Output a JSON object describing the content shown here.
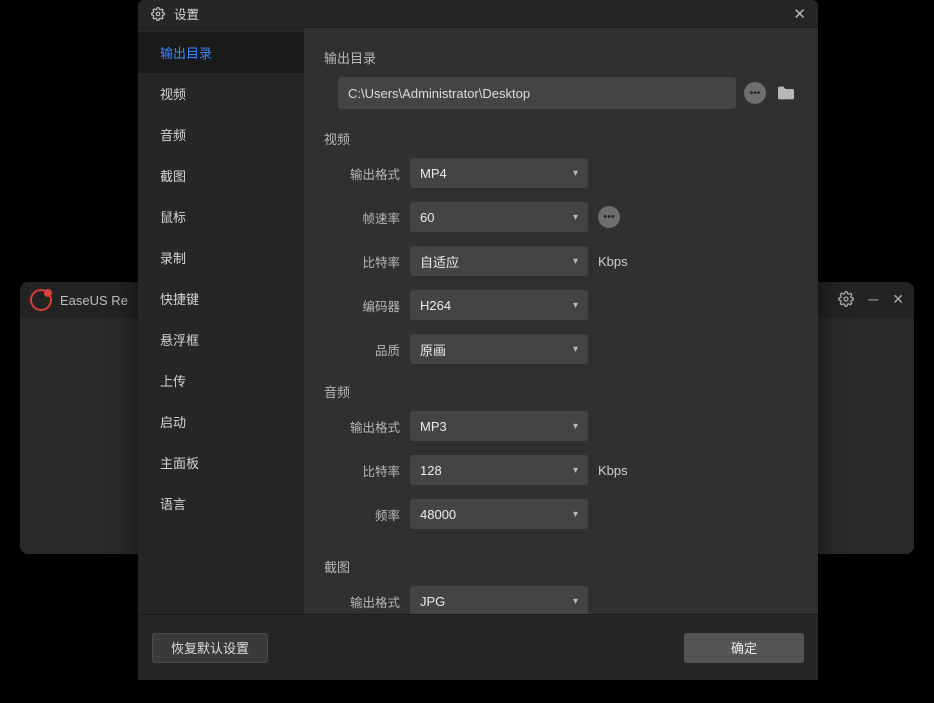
{
  "app": {
    "title": "EaseUS Re"
  },
  "modal": {
    "title": "设置"
  },
  "sidebar": {
    "items": [
      {
        "label": "输出目录",
        "active": true
      },
      {
        "label": "视频"
      },
      {
        "label": "音频"
      },
      {
        "label": "截图"
      },
      {
        "label": "鼠标"
      },
      {
        "label": "录制"
      },
      {
        "label": "快捷键"
      },
      {
        "label": "悬浮框"
      },
      {
        "label": "上传"
      },
      {
        "label": "启动"
      },
      {
        "label": "主面板"
      },
      {
        "label": "语言"
      }
    ]
  },
  "sections": {
    "output_dir": {
      "title": "输出目录",
      "path": "C:\\Users\\Administrator\\Desktop"
    },
    "video": {
      "title": "视频",
      "format_label": "输出格式",
      "format_value": "MP4",
      "framerate_label": "帧速率",
      "framerate_value": "60",
      "bitrate_label": "比特率",
      "bitrate_value": "自适应",
      "bitrate_suffix": "Kbps",
      "encoder_label": "编码器",
      "encoder_value": "H264",
      "quality_label": "品质",
      "quality_value": "原画"
    },
    "audio": {
      "title": "音频",
      "format_label": "输出格式",
      "format_value": "MP3",
      "bitrate_label": "比特率",
      "bitrate_value": "128",
      "bitrate_suffix": "Kbps",
      "samplerate_label": "频率",
      "samplerate_value": "48000"
    },
    "screenshot": {
      "title": "截图",
      "format_label": "输出格式",
      "format_value": "JPG"
    }
  },
  "footer": {
    "reset": "恢复默认设置",
    "ok": "确定"
  }
}
